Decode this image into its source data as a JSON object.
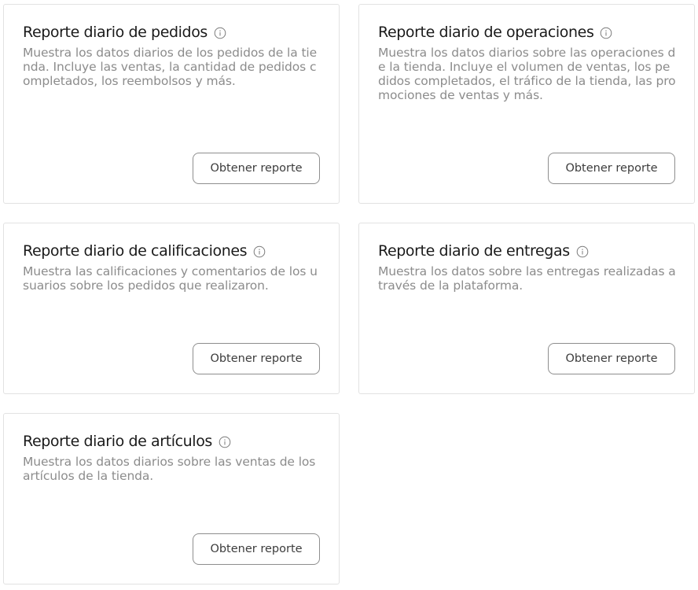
{
  "cards": [
    {
      "title": "Reporte diario de pedidos",
      "description": "Muestra los datos diarios de los pedidos de la tienda. Incluye las ventas, la cantidad de pedidos completados, los reembolsos y más.",
      "button_label": "Obtener reporte"
    },
    {
      "title": "Reporte diario de operaciones",
      "description": "Muestra los datos diarios sobre las operaciones de la tienda. Incluye el volumen de ventas, los pedidos completados, el tráfico de la tienda, las promociones de ventas y más.",
      "button_label": "Obtener reporte"
    },
    {
      "title": "Reporte diario de calificaciones",
      "description": "Muestra las calificaciones y comentarios de los usuarios sobre los pedidos que realizaron.",
      "button_label": "Obtener reporte"
    },
    {
      "title": "Reporte diario de entregas",
      "description": "Muestra los datos sobre las entregas realizadas a través de la plataforma.",
      "button_label": "Obtener reporte"
    },
    {
      "title": "Reporte diario de artículos",
      "description": "Muestra los datos diarios sobre las ventas de los artículos de la tienda.",
      "button_label": "Obtener reporte"
    }
  ],
  "icons": {
    "info": "info-circle-icon"
  },
  "colors": {
    "title": "#1a1a1a",
    "description": "#8c8c8c",
    "card_border": "#e2e2e2",
    "button_border": "#8e8e8e"
  }
}
